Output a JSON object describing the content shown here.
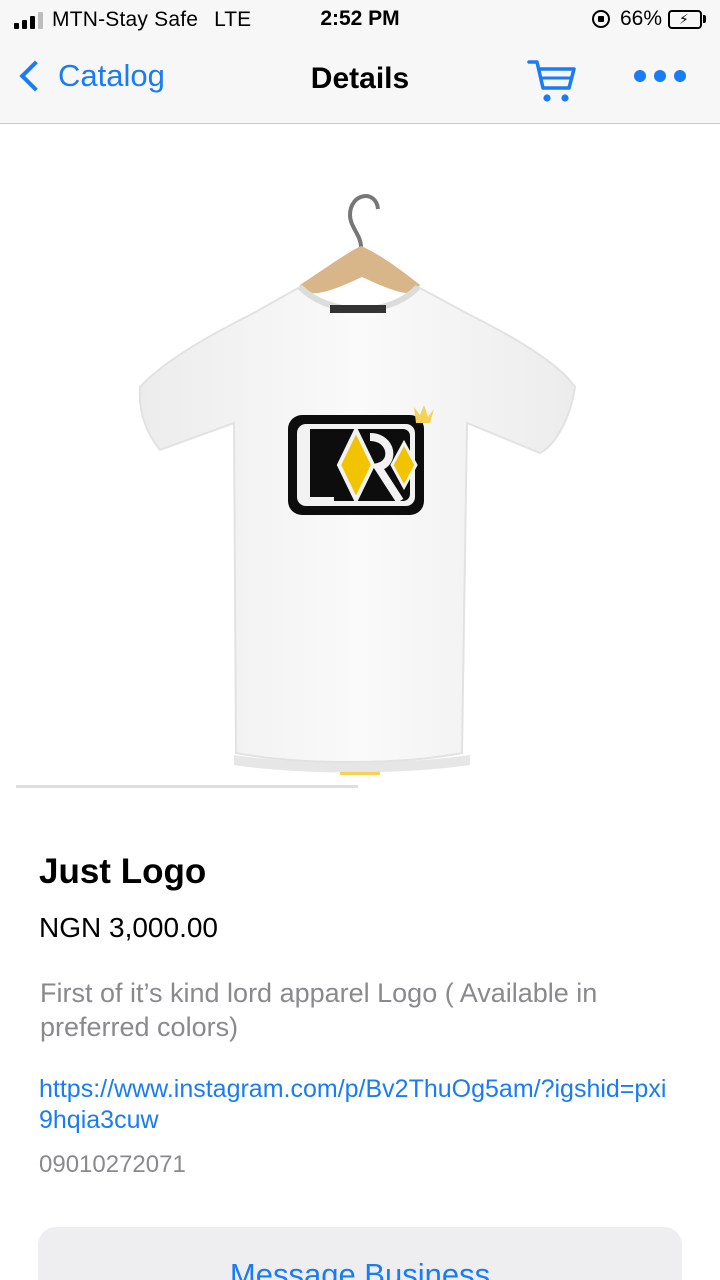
{
  "status_bar": {
    "carrier": "MTN-Stay Safe",
    "network": "LTE",
    "time": "2:52 PM",
    "battery": "66%",
    "battery_level": 0.66
  },
  "nav": {
    "back_label": "Catalog",
    "title": "Details",
    "cart_icon": "cart-icon",
    "more_icon": "more-icon"
  },
  "product": {
    "image_icon": "tshirt-photo",
    "logo_text": "LORD",
    "name": "Just Logo",
    "price": "NGN 3,000.00",
    "description": "First of it’s kind lord apparel Logo ( Available in preferred colors)",
    "link": "https://www.instagram.com/p/Bv2ThuOg5am/?igshid=pxi9hqia3cuw",
    "phone": "09010272071"
  },
  "actions": {
    "message_label": "Message Business"
  },
  "colors": {
    "accent": "#1a7cf5",
    "bar_bg": "#f7f7f7",
    "secondary_text": "#8a8a8e",
    "logo_yellow": "#f2c400"
  }
}
